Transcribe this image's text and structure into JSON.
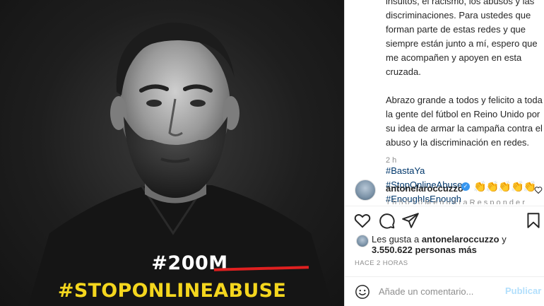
{
  "photo": {
    "crossed_hashtag": "#200M",
    "campaign_hashtag": "#STOPONLINEABUSE"
  },
  "caption": {
    "paragraph1": "insultos, el racismo, los abusos y las\ndiscriminaciones. Para ustedes que\nforman parte de estas redes y que\nsiempre están junto a mí, espero que\nme acompañen y apoyen en esta\ncruzada.",
    "paragraph2": "Abrazo grande a todos y felicito a toda\nla gente del fútbol en Reino Unido por\nsu idea de armar la campaña contra el\nabuso y la discriminación en redes.",
    "tags": [
      "#BastaYa",
      "#StopOnlineAbuse",
      "#EnoughIsEnough"
    ],
    "time": "2 h"
  },
  "comment": {
    "username": "antonelaroccuzzo",
    "emojis": "👏👏👏👏👏",
    "truncated_line": "1 h   5 0 1 0  M e g u s t a   R e s p o n d e r"
  },
  "likes": {
    "prefix": "Les gusta a ",
    "user": "antonelaroccuzzo",
    "suffix": " y",
    "count": "3.550.622 personas más"
  },
  "timestamp": "HACE 2 HORAS",
  "add_comment": {
    "placeholder": "Añade un comentario...",
    "publish_label": "Publicar"
  },
  "colors": {
    "campaign_yellow": "#f4d61e",
    "strike_red": "#e02020",
    "hashtag_link": "#00376b",
    "verified_blue": "#3897f0",
    "publish_disabled": "#b2dffc"
  },
  "icons": [
    "heart-icon",
    "comment-icon",
    "share-icon",
    "bookmark-icon",
    "smiley-icon",
    "verified-icon",
    "comment-like-icon"
  ]
}
